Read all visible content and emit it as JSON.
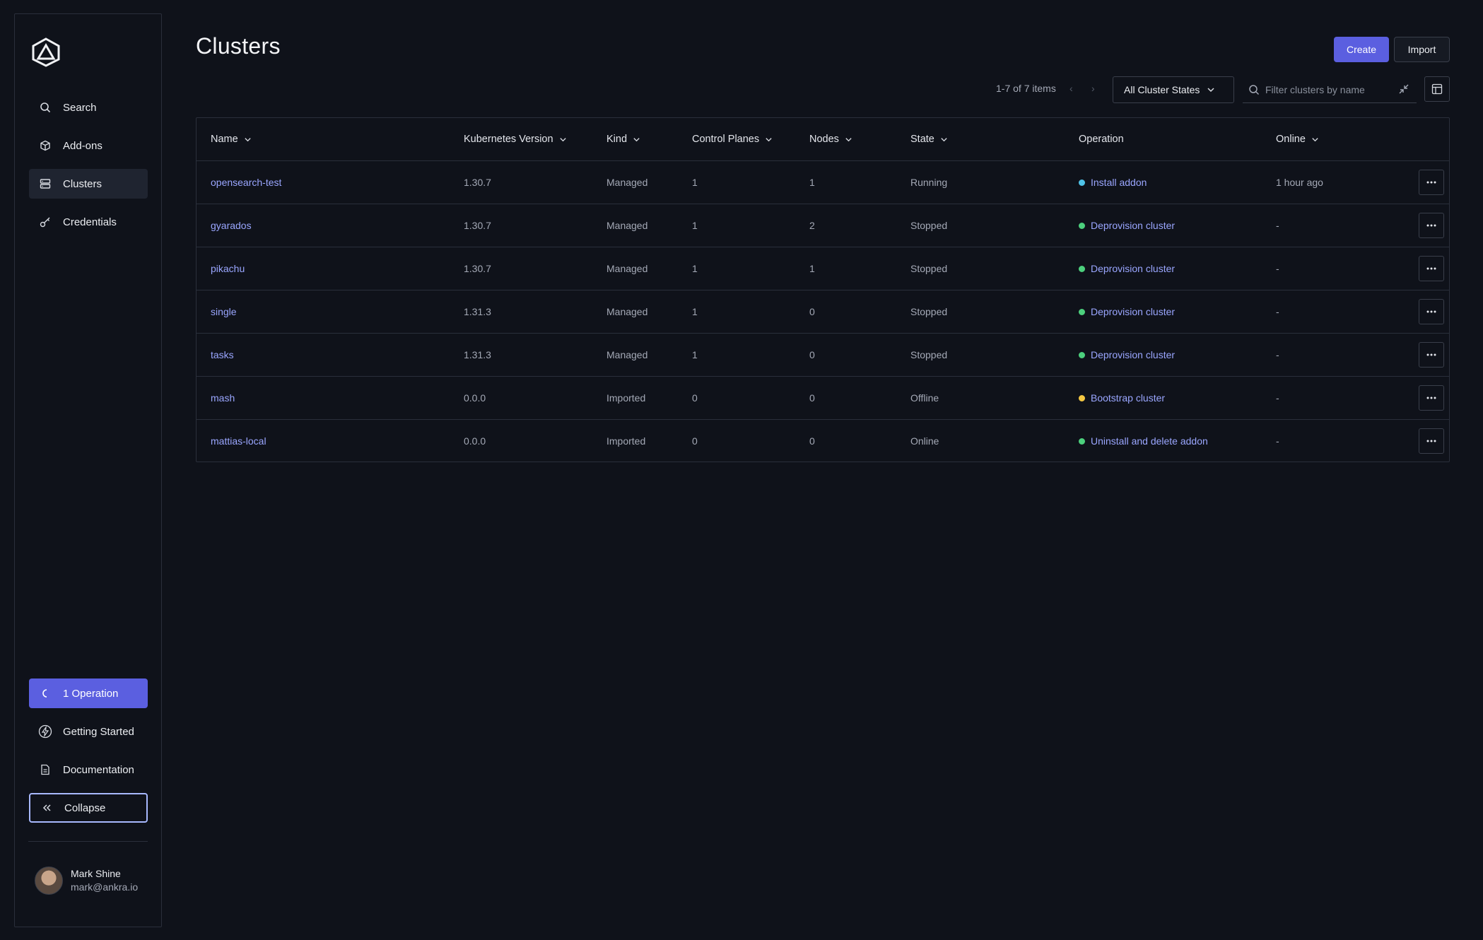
{
  "sidebar": {
    "nav": [
      {
        "label": "Search",
        "icon": "search-icon"
      },
      {
        "label": "Add-ons",
        "icon": "package-icon"
      },
      {
        "label": "Clusters",
        "icon": "server-icon",
        "active": true
      },
      {
        "label": "Credentials",
        "icon": "key-icon"
      }
    ],
    "operation_label": "1 Operation",
    "getting_started": "Getting Started",
    "documentation": "Documentation",
    "collapse": "Collapse",
    "user": {
      "name": "Mark Shine",
      "email": "mark@ankra.io"
    }
  },
  "header": {
    "title": "Clusters",
    "create_label": "Create",
    "import_label": "Import"
  },
  "toolbar": {
    "pager_text": "1-7 of 7 items",
    "prev": "‹",
    "next": "›",
    "states_label": "All Cluster States",
    "filter_placeholder": "Filter clusters by name"
  },
  "table": {
    "columns": {
      "name": "Name",
      "k8s": "Kubernetes Version",
      "kind": "Kind",
      "cp": "Control Planes",
      "nodes": "Nodes",
      "state": "State",
      "op": "Operation",
      "online": "Online"
    },
    "rows": [
      {
        "name": "opensearch-test",
        "k8s": "1.30.7",
        "kind": "Managed",
        "cp": "1",
        "nodes": "1",
        "state": "Running",
        "op": "Install addon",
        "op_color": "#4fc3e8",
        "online": "1 hour ago"
      },
      {
        "name": "gyarados",
        "k8s": "1.30.7",
        "kind": "Managed",
        "cp": "1",
        "nodes": "2",
        "state": "Stopped",
        "op": "Deprovision cluster",
        "op_color": "#4cd07d",
        "online": "-"
      },
      {
        "name": "pikachu",
        "k8s": "1.30.7",
        "kind": "Managed",
        "cp": "1",
        "nodes": "1",
        "state": "Stopped",
        "op": "Deprovision cluster",
        "op_color": "#4cd07d",
        "online": "-"
      },
      {
        "name": "single",
        "k8s": "1.31.3",
        "kind": "Managed",
        "cp": "1",
        "nodes": "0",
        "state": "Stopped",
        "op": "Deprovision cluster",
        "op_color": "#4cd07d",
        "online": "-"
      },
      {
        "name": "tasks",
        "k8s": "1.31.3",
        "kind": "Managed",
        "cp": "1",
        "nodes": "0",
        "state": "Stopped",
        "op": "Deprovision cluster",
        "op_color": "#4cd07d",
        "online": "-"
      },
      {
        "name": "mash",
        "k8s": "0.0.0",
        "kind": "Imported",
        "cp": "0",
        "nodes": "0",
        "state": "Offline",
        "op": "Bootstrap cluster",
        "op_color": "#f5c842",
        "online": "-"
      },
      {
        "name": "mattias-local",
        "k8s": "0.0.0",
        "kind": "Imported",
        "cp": "0",
        "nodes": "0",
        "state": "Online",
        "op": "Uninstall and delete addon",
        "op_color": "#4cd07d",
        "online": "-"
      }
    ]
  },
  "colors": {
    "accent": "#5b5fe0",
    "link": "#9aa6ff",
    "background": "#0f121a"
  }
}
